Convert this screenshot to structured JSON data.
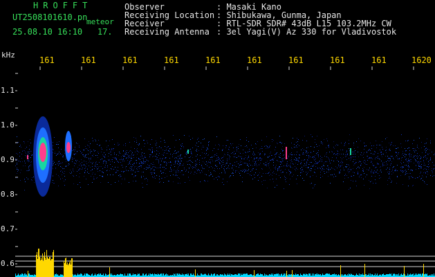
{
  "app": {
    "name": "HROFFT"
  },
  "file": {
    "name": "UT2508101610.pn",
    "label": "meteor",
    "timestamp": "25.08.10 16:10",
    "value": "17."
  },
  "header": {
    "rows": [
      {
        "key": "Observer",
        "value": ": Masaki Kano"
      },
      {
        "key": "Receiving Location",
        "value": ": Shibukawa, Gunma, Japan"
      },
      {
        "key": "Receiver",
        "value": ": RTL-SDR SDR# 43dB L15 103.2MHz CW"
      },
      {
        "key": "Receiving Antenna",
        "value": ": 3el Yagi(V) Az 330 for Vladivostok"
      }
    ]
  },
  "axes": {
    "y_unit": "kHz",
    "y_ticks": [
      "1.1",
      "1.0",
      "0.9",
      "0.8",
      "0.7",
      "0.6"
    ],
    "x_ticks": [
      "161",
      "161",
      "161",
      "161",
      "161",
      "161",
      "161",
      "161",
      "161",
      "1620"
    ]
  },
  "colors": {
    "green": "#37e05a",
    "yellow": "#ffd800",
    "cyan": "#00d8ff",
    "pink": "#ff3d8c",
    "white": "#e8e8e8"
  }
}
